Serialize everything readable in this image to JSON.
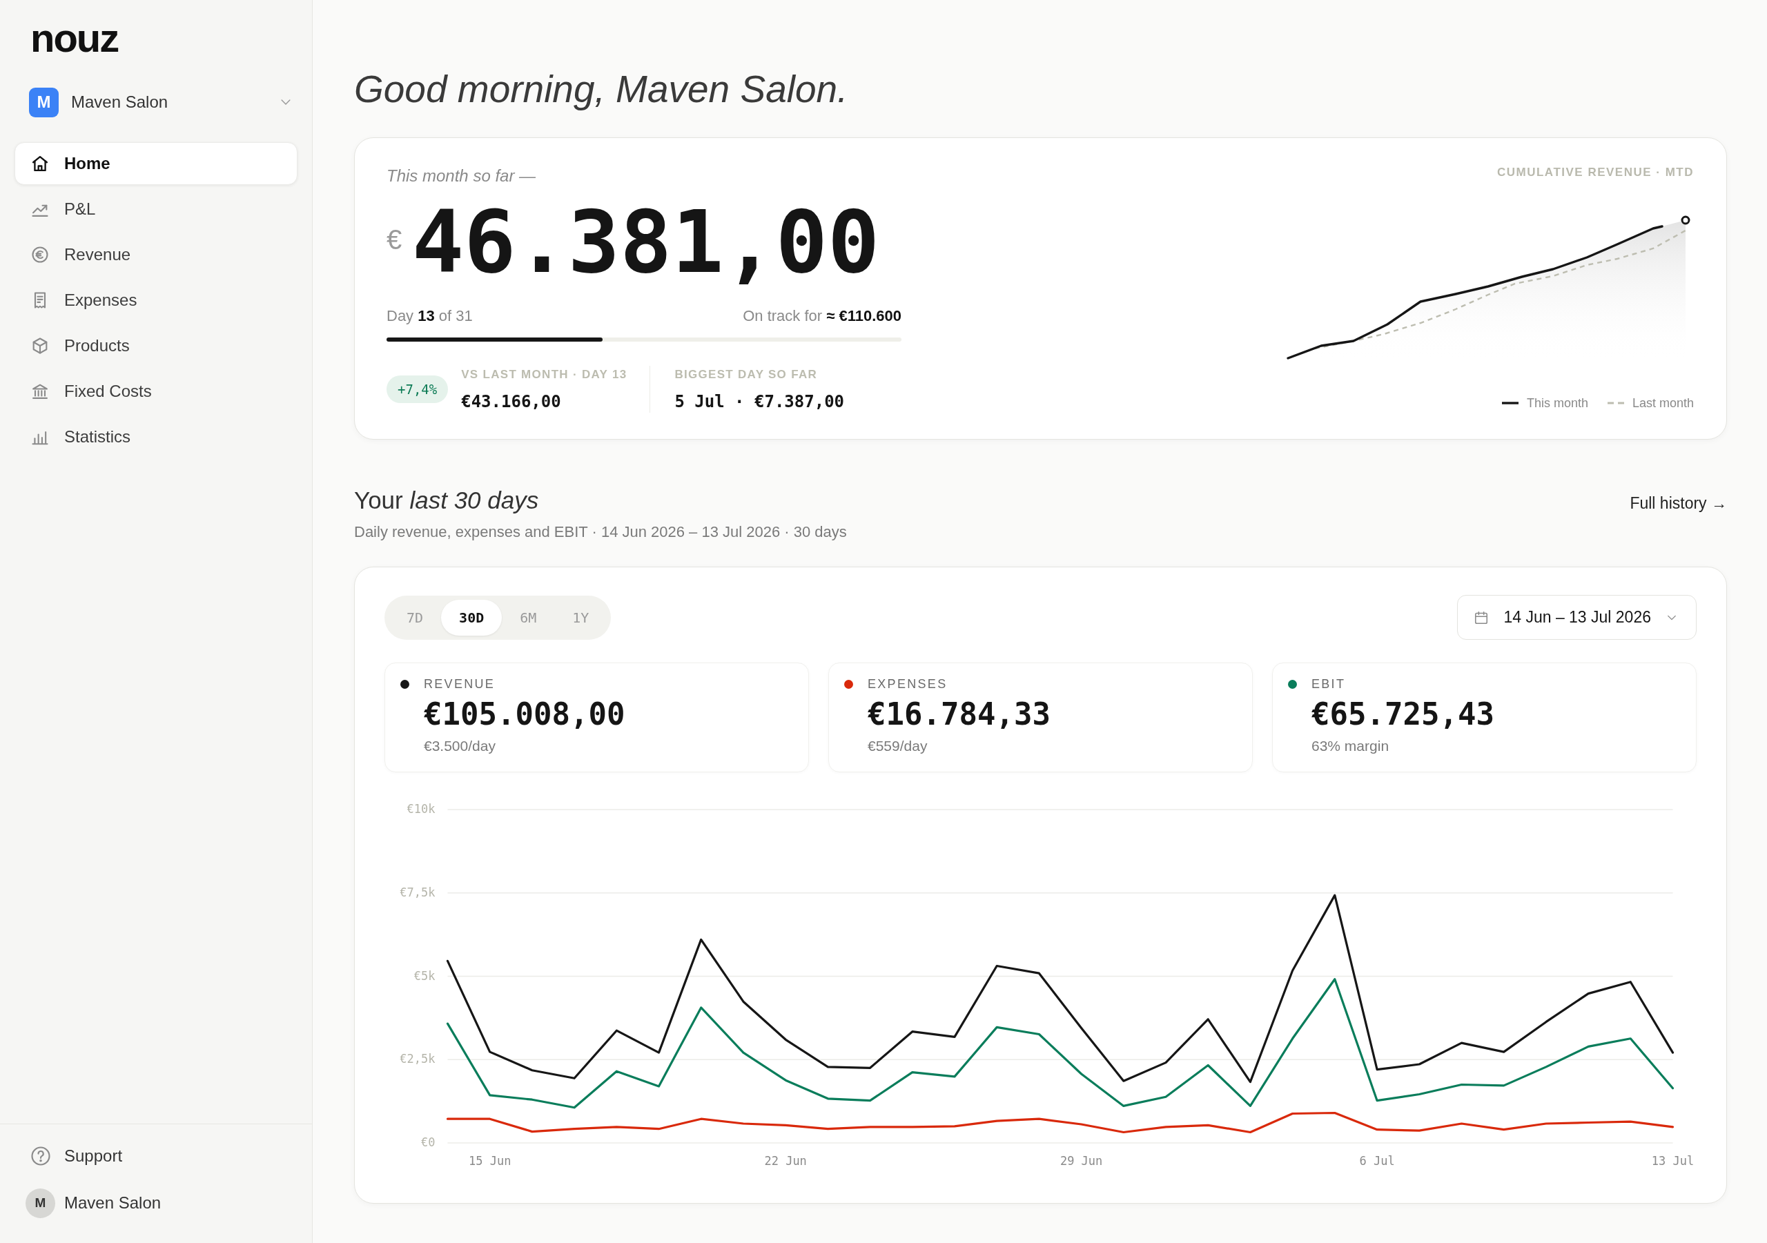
{
  "sidebar": {
    "logo": "nouz",
    "workspace": {
      "initial": "M",
      "name": "Maven Salon"
    },
    "nav_items": [
      {
        "label": "Home",
        "selected": true
      },
      {
        "label": "P&L",
        "selected": false
      },
      {
        "label": "Revenue",
        "selected": false
      },
      {
        "label": "Expenses",
        "selected": false
      },
      {
        "label": "Products",
        "selected": false
      },
      {
        "label": "Fixed Costs",
        "selected": false
      },
      {
        "label": "Statistics",
        "selected": false
      }
    ],
    "footer_items": [
      {
        "kind": "help",
        "label": "Support"
      },
      {
        "kind": "account",
        "initial": "M",
        "label": "Maven Salon"
      }
    ]
  },
  "greeting": "Good morning, Maven Salon.",
  "hero": {
    "caption": "This month so far —",
    "currency": "€",
    "amount": "46.381,00",
    "progress": {
      "day_text": "Day **13** of 31",
      "forecast": "On track for **≈ €110.600**",
      "level": 0.42
    },
    "comparisons": [
      {
        "badge": "+7,4%",
        "label": "VS LAST MONTH · DAY 13",
        "value": "€43.166,00"
      },
      {
        "label": "BIGGEST DAY SO FAR",
        "value": "5 Jul · €7.387,00"
      }
    ],
    "cumulative_chart": {
      "title": "CUMULATIVE REVENUE · MTD",
      "legend": [
        {
          "kind": "solid",
          "label": "This month"
        },
        {
          "kind": "dashed",
          "label": "Last month"
        }
      ]
    }
  },
  "last_30_days": {
    "title": "Your *last 30 days*",
    "subtitle": "Daily revenue, expenses and EBIT · 14 Jun 2026 – 13 Jul 2026 · 30 days",
    "link": "Full history →",
    "range_tabs": [
      {
        "label": "7D",
        "selected": false
      },
      {
        "label": "30D",
        "selected": true
      },
      {
        "label": "6M",
        "selected": false
      },
      {
        "label": "1Y",
        "selected": false
      }
    ],
    "date_range": "14 Jun – 13 Jul 2026",
    "stats": [
      {
        "label": "REVENUE",
        "color": "#161616",
        "value": "€105.008,00",
        "sub": "€3.500/day"
      },
      {
        "label": "EXPENSES",
        "color": "#d9290b",
        "value": "€16.784,33",
        "sub": "€559/day"
      },
      {
        "label": "EBIT",
        "color": "#0a7d5b",
        "value": "€65.725,43",
        "sub": "63% margin"
      }
    ],
    "chart_data": {
      "type": "line",
      "grid": true,
      "categories": [
        null,
        "15 Jun",
        null,
        null,
        null,
        null,
        null,
        null,
        "22 Jun",
        null,
        null,
        null,
        null,
        null,
        null,
        "29 Jun",
        null,
        null,
        null,
        null,
        null,
        null,
        "6 Jul",
        null,
        null,
        null,
        null,
        null,
        null,
        "13 Jul"
      ],
      "ylim": [
        0,
        10000
      ],
      "yticks": [
        {
          "value": 0,
          "label": "€0"
        },
        {
          "value": 2500,
          "label": "€2,5k"
        },
        {
          "value": 5000,
          "label": "€5k"
        },
        {
          "value": 7500,
          "label": "€7,5k"
        },
        {
          "value": 10000,
          "label": "€10k"
        }
      ],
      "series": [
        {
          "color": "#161616",
          "values": [
            5460,
            2730,
            2180,
            1940,
            3370,
            2710,
            6100,
            4240,
            3100,
            2280,
            2250,
            3340,
            3180,
            5310,
            5090,
            3450,
            1860,
            2410,
            3710,
            1830,
            5170,
            7430,
            2200,
            2360,
            3000,
            2730,
            3630,
            4480,
            4830,
            2710
          ]
        },
        {
          "color": "#d9290b",
          "values": [
            720,
            720,
            340,
            420,
            480,
            420,
            720,
            580,
            530,
            420,
            480,
            480,
            500,
            660,
            720,
            560,
            320,
            480,
            530,
            320,
            880,
            900,
            400,
            370,
            580,
            400,
            580,
            610,
            640,
            480
          ]
        },
        {
          "color": "#0a7d5b",
          "values": [
            3580,
            1430,
            1300,
            1060,
            2150,
            1700,
            4060,
            2710,
            1880,
            1330,
            1270,
            2120,
            1990,
            3470,
            3260,
            2070,
            1110,
            1380,
            2330,
            1110,
            3130,
            4910,
            1270,
            1460,
            1750,
            1720,
            2280,
            2890,
            3130,
            1640
          ]
        }
      ]
    }
  }
}
